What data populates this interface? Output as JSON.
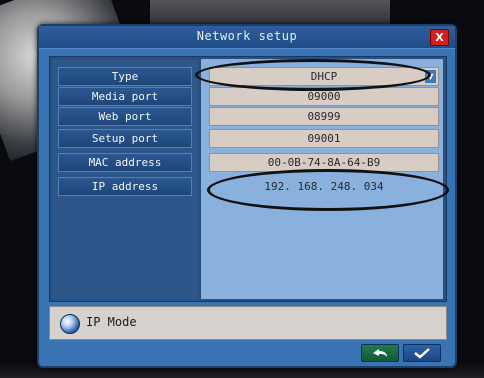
{
  "dialog": {
    "title": "Network setup",
    "close_label": "X"
  },
  "fields": [
    {
      "label": "Type",
      "value": "DHCP"
    },
    {
      "label": "Media port",
      "value": "09000"
    },
    {
      "label": "Web port",
      "value": "08999"
    },
    {
      "label": "Setup port",
      "value": "09001"
    },
    {
      "label": "MAC address",
      "value": "00-0B-74-8A-64-B9"
    },
    {
      "label": "IP address",
      "value": "192. 168. 248. 034"
    }
  ],
  "status": {
    "icon": "info-icon",
    "text": "IP Mode"
  },
  "buttons": {
    "cancel_icon": "undo-icon",
    "ok_icon": "check-icon"
  },
  "colors": {
    "dialog_bg": "#3a73b3",
    "label_bg": "#1e4578",
    "value_bg": "#d7cdc5",
    "close_red": "#d21f1f"
  }
}
